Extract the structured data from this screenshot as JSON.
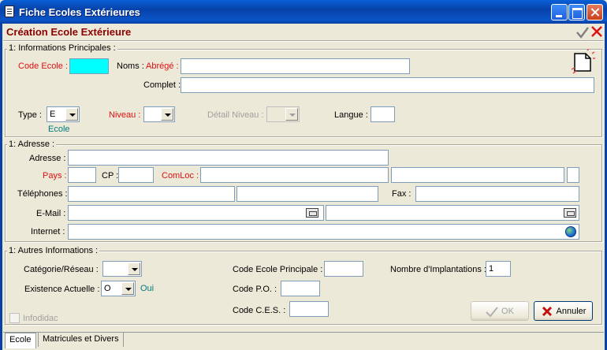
{
  "window": {
    "title": "Fiche Ecoles Extérieures"
  },
  "form": {
    "title": "Création Ecole Extérieure"
  },
  "group_principal": {
    "title": "1: Informations Principales :",
    "code_ecole_label": "Code Ecole :",
    "code_ecole_value": "",
    "noms_label": "Noms :",
    "abrege_label": "Abrégé :",
    "abrege_value": "",
    "complet_label": "Complet :",
    "complet_value": "",
    "type_label": "Type :",
    "type_value": "E",
    "type_caption": "Ecole",
    "niveau_label": "Niveau :",
    "niveau_value": "",
    "detail_niveau_label": "Détail Niveau :",
    "detail_niveau_value": "",
    "langue_label": "Langue :",
    "langue_value": ""
  },
  "group_adresse": {
    "title": "1: Adresse :",
    "adresse_label": "Adresse :",
    "adresse_value": "",
    "pays_label": "Pays :",
    "pays_value": "",
    "cp_label": "CP :",
    "cp_value": "",
    "comloc_label": "ComLoc :",
    "telephones_label": "Téléphones :",
    "fax_label": "Fax :",
    "email_label": "E-Mail :",
    "internet_label": "Internet :"
  },
  "group_autres": {
    "title": "1: Autres Informations :",
    "categorie_label": "Catégorie/Réseau :",
    "categorie_value": "",
    "existence_label": "Existence Actuelle :",
    "existence_value": "O",
    "existence_caption": "Oui",
    "code_principale_label": "Code Ecole Principale :",
    "code_po_label": "Code P.O. :",
    "code_ces_label": "Code C.E.S. :",
    "nb_implantations_label": "Nombre d'Implantations :",
    "nb_implantations_value": "1"
  },
  "footer": {
    "infodidac_label": "Infodidac",
    "ok_label": "OK",
    "annuler_label": "Annuler"
  },
  "tabs": [
    {
      "label": "Ecole"
    },
    {
      "label": "Matricules et Divers"
    }
  ],
  "colors": {
    "title_bar": "#0842a9",
    "form_title": "#8b0000",
    "required_label": "#e01010",
    "caption_teal": "#007a80",
    "code_field": "#00ffff"
  }
}
